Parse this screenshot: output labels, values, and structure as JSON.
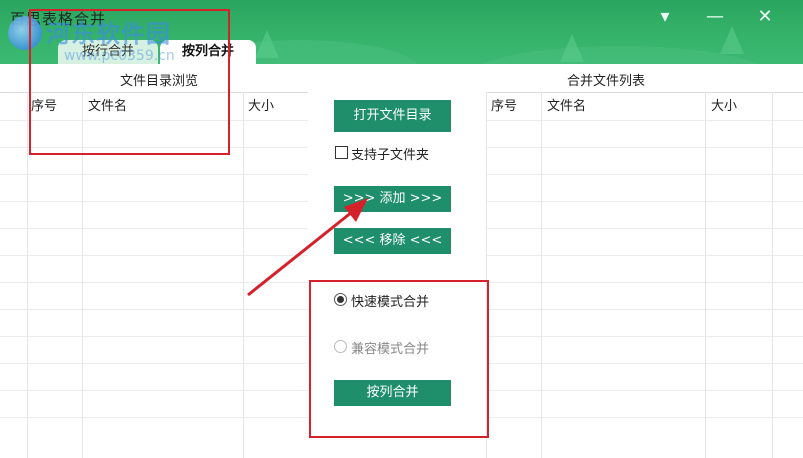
{
  "window": {
    "title": "百思表格合并",
    "controls": {
      "menu": "▾",
      "minimize": "—",
      "close": "✕"
    }
  },
  "watermark": {
    "site": "河东软件园",
    "url": "www.pc0359.cn"
  },
  "tabs": [
    {
      "label": "按行合并",
      "active": false
    },
    {
      "label": "按列合并",
      "active": true
    }
  ],
  "left_panel": {
    "title": "文件目录浏览",
    "columns": [
      "序号",
      "文件名",
      "大小"
    ]
  },
  "right_panel": {
    "title": "合并文件列表",
    "columns": [
      "序号",
      "文件名",
      "大小"
    ]
  },
  "middle": {
    "open_dir_button": "打开文件目录",
    "include_subfolders_label": "支持子文件夹",
    "include_subfolders_checked": false,
    "add_button": ">>> 添加 >>>",
    "remove_button": "<<< 移除 <<<",
    "modes": [
      {
        "label": "快速模式合并",
        "selected": true,
        "enabled": true
      },
      {
        "label": "兼容模式合并",
        "selected": false,
        "enabled": false
      }
    ],
    "merge_button": "按列合并"
  },
  "colors": {
    "accent": "#1e8f6a",
    "titlebar": "#36b36b",
    "annotation": "#d4212a"
  }
}
